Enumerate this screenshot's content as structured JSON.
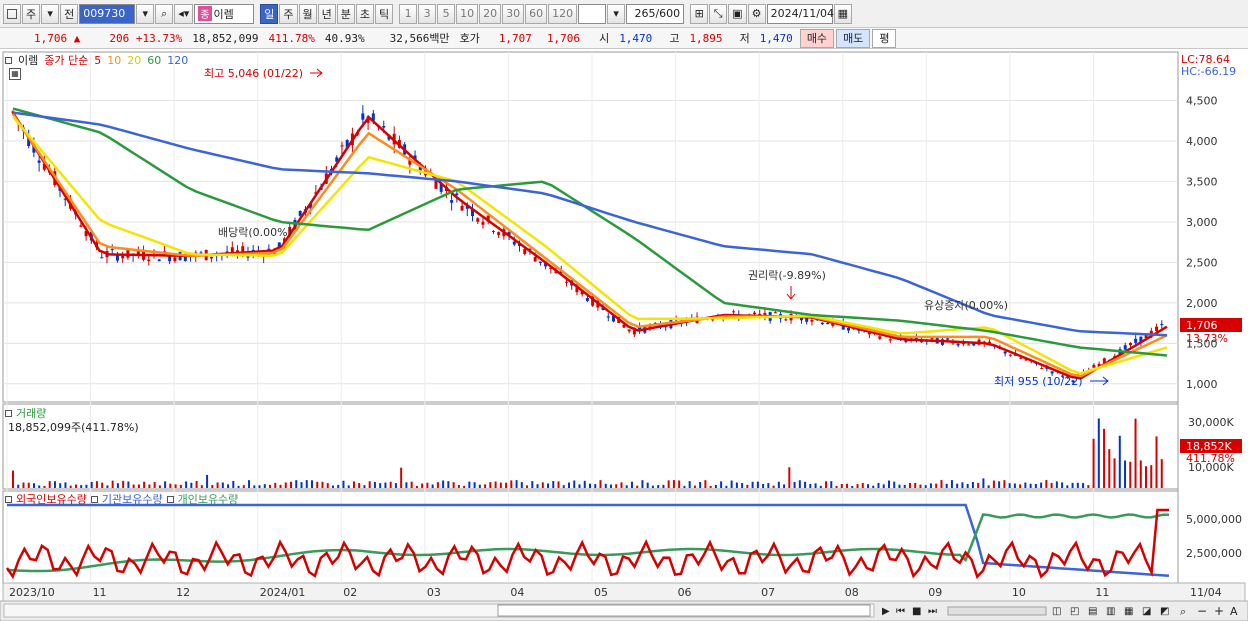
{
  "toolbar": {
    "period_label": "주",
    "prev_label": "전",
    "stock_code": "009730",
    "badge": "종",
    "stock_name": "이렘",
    "tabs": [
      "일",
      "주",
      "월",
      "년",
      "분",
      "초",
      "틱"
    ],
    "intervals": [
      "1",
      "3",
      "5",
      "10",
      "20",
      "30",
      "60",
      "120"
    ],
    "count": "265",
    "count_max": "/600",
    "date": "2024/11/04"
  },
  "quote": {
    "price": "1,706",
    "change": "206",
    "change_pct": "+13.73%",
    "volume": "18,852,099",
    "volume_ratio": "411.78%",
    "turnover": "40.93%",
    "amount": "32,566백만",
    "hoga_label": "호가",
    "ask": "1,707",
    "bid": "1,706",
    "open_label": "시",
    "open": "1,470",
    "high_label": "고",
    "high": "1,895",
    "low_label": "저",
    "low": "1,470",
    "buy_label": "매수",
    "sell_label": "매도",
    "flat_label": "평"
  },
  "legend": {
    "name": "이렘",
    "ma_label": "종가 단순",
    "ma_periods": [
      "5",
      "10",
      "20",
      "60",
      "120"
    ],
    "volume_label": "거래량",
    "volume_value": "18,852,099주(411.78%)",
    "own_foreign": "외국인보유수량",
    "own_inst": "기관보유수량",
    "own_indiv": "개인보유수량"
  },
  "annotations": {
    "high": "최고 5,046 (01/22)",
    "low": "최저 955 (10/22)",
    "dividend": "배당락(0.00%)",
    "rights": "권리락(-9.89%)",
    "bonus": "유상증자(0.00%)"
  },
  "right_axis": {
    "lc": "LC:78.64",
    "hc": "HC:-66.19",
    "price_ticks": [
      "4,500",
      "4,000",
      "3,500",
      "3,000",
      "2,500",
      "2,000",
      "1,500",
      "1,000"
    ],
    "current_price": "1,706",
    "current_pct": "13.73%",
    "volume_ticks": [
      "30,000K",
      "10,000K"
    ],
    "current_volume": "18,852K",
    "current_volume_pct": "411.78%",
    "own_ticks": [
      "5,000,000",
      "2,500,000"
    ]
  },
  "x_axis": [
    "2023/10",
    "11",
    "12",
    "2024/01",
    "02",
    "03",
    "04",
    "05",
    "06",
    "07",
    "08",
    "09",
    "10",
    "11"
  ],
  "x_axis_right": "11/04",
  "colors": {
    "up": "#d60000",
    "down": "#0033cc",
    "ma5": "#d60000",
    "ma10": "#ff8c1a",
    "ma20": "#f2e600",
    "ma60": "#2a9a3a",
    "ma120": "#3a64d8",
    "foreign": "#d60000",
    "inst": "#3a64d8",
    "indiv": "#3a9a5a"
  },
  "chart_data": {
    "type": "line",
    "title": "",
    "x": [
      "2023/10",
      "11",
      "12",
      "2024/01",
      "02",
      "03",
      "04",
      "05",
      "06",
      "07",
      "08",
      "09",
      "10",
      "11"
    ],
    "series": [
      {
        "name": "5",
        "values": [
          4350,
          2600,
          2580,
          2650,
          4300,
          3300,
          2500,
          1650,
          1850,
          1820,
          1550,
          1500,
          1050,
          1706
        ]
      },
      {
        "name": "10",
        "values": [
          4330,
          2700,
          2580,
          2620,
          4100,
          3400,
          2550,
          1700,
          1830,
          1830,
          1580,
          1580,
          1080,
          1600
        ]
      },
      {
        "name": "20",
        "values": [
          4300,
          3000,
          2600,
          2580,
          3800,
          3500,
          2700,
          1800,
          1810,
          1840,
          1620,
          1700,
          1120,
          1450
        ]
      },
      {
        "name": "60",
        "values": [
          4400,
          4100,
          3400,
          3000,
          2900,
          3400,
          3500,
          2800,
          2000,
          1850,
          1780,
          1650,
          1450,
          1350
        ]
      },
      {
        "name": "120",
        "values": [
          4350,
          4200,
          3900,
          3650,
          3600,
          3500,
          3350,
          3000,
          2700,
          2600,
          2300,
          1850,
          1650,
          1600
        ]
      }
    ],
    "ylim": [
      800,
      5000
    ],
    "high_point": 5046,
    "low_point": 955,
    "current": 1706
  }
}
